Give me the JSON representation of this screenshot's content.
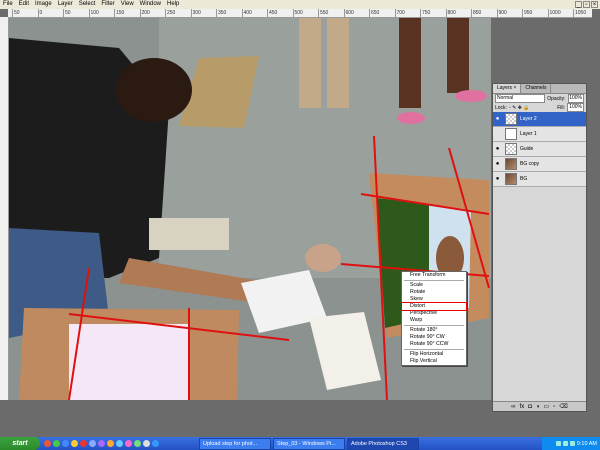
{
  "menu": [
    "File",
    "Edit",
    "Image",
    "Layer",
    "Select",
    "Filter",
    "View",
    "Window",
    "Help"
  ],
  "ruler_ticks": [
    "50",
    "0",
    "50",
    "100",
    "150",
    "200",
    "250",
    "300",
    "350",
    "400",
    "450",
    "500",
    "550",
    "600",
    "650",
    "700",
    "750",
    "800",
    "850",
    "900",
    "950",
    "1000",
    "1050"
  ],
  "layers_panel": {
    "tabs": [
      "Layers ×",
      "Channels"
    ],
    "blend_mode": "Normal",
    "opacity_label": "Opacity:",
    "opacity_value": "100%",
    "lock_label": "Lock:",
    "fill_label": "Fill:",
    "fill_value": "100%",
    "layers": [
      {
        "name": "Layer 2",
        "selected": true,
        "thumb": "checker"
      },
      {
        "name": "Layer 1",
        "selected": false,
        "thumb": "white"
      },
      {
        "name": "Guide",
        "selected": false,
        "thumb": "checker"
      },
      {
        "name": "BG copy",
        "selected": false,
        "thumb": "photo"
      },
      {
        "name": "BG",
        "selected": false,
        "thumb": "photo"
      }
    ]
  },
  "context_menu": {
    "items": [
      "Free Transform",
      "Scale",
      "Rotate",
      "Skew",
      "Distort",
      "Perspective",
      "Warp",
      "Rotate 180°",
      "Rotate 90° CW",
      "Rotate 90° CCW",
      "Flip Horizontal",
      "Flip Vertical"
    ],
    "highlighted": "Distort"
  },
  "taskbar": {
    "start": "start",
    "buttons": [
      "Upload step for phot...",
      "Step_03 - Windows Pi...",
      "Adobe Photoshop CS3"
    ],
    "clock": "9:10 AM"
  },
  "colors": {
    "guide_lines": "#e01010",
    "selected_layer": "#3264c8",
    "taskbar": "#2452c4"
  }
}
